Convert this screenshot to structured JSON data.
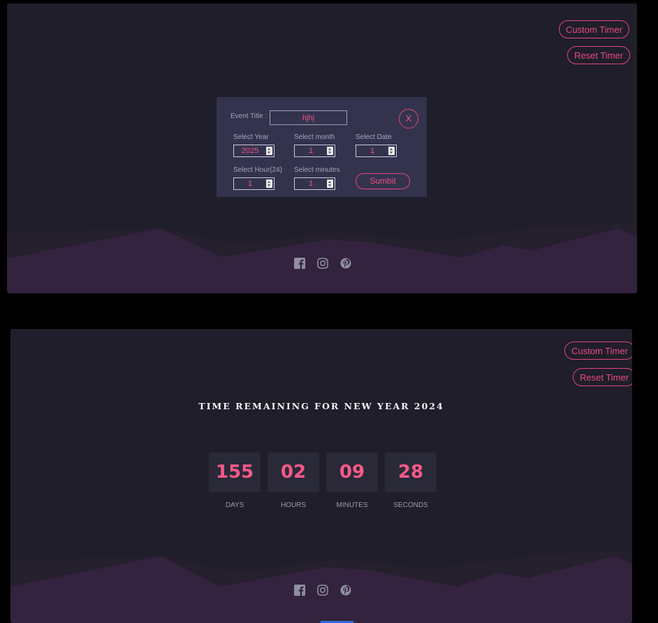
{
  "colors": {
    "background": "#1f1e2a",
    "accent": "#e0477a",
    "modal_bg": "#34334e",
    "mountain_dark": "#2b2233",
    "mountain_main": "#33233e"
  },
  "top_panel": {
    "buttons": {
      "custom_timer": "Custom Timer",
      "reset_timer": "Reset Timer"
    },
    "modal": {
      "event_title_label": "Event Title :",
      "event_title_value": "hjhj",
      "close_label": "X",
      "select_year_label": "Select Year",
      "select_year_value": "2025",
      "select_month_label": "Select month",
      "select_month_value": "1",
      "select_date_label": "Select Date",
      "select_date_value": "1",
      "select_hour_label": "Select Hour(24)",
      "select_hour_value": "1",
      "select_minutes_label": "Select minutes",
      "select_minutes_value": "1",
      "submit_label": "Sumbit"
    },
    "social_icons": [
      "facebook-icon",
      "instagram-icon",
      "pinterest-icon"
    ]
  },
  "bottom_panel": {
    "buttons": {
      "custom_timer": "Custom Timer",
      "reset_timer": "Reset Timer"
    },
    "title": "TIME REMAINING FOR NEW YEAR 2024",
    "countdown": [
      {
        "value": "155",
        "label": "DAYS"
      },
      {
        "value": "02",
        "label": "HOURS"
      },
      {
        "value": "09",
        "label": "MINUTES"
      },
      {
        "value": "28",
        "label": "SECONDS"
      }
    ],
    "social_icons": [
      "facebook-icon",
      "instagram-icon",
      "pinterest-icon"
    ]
  }
}
